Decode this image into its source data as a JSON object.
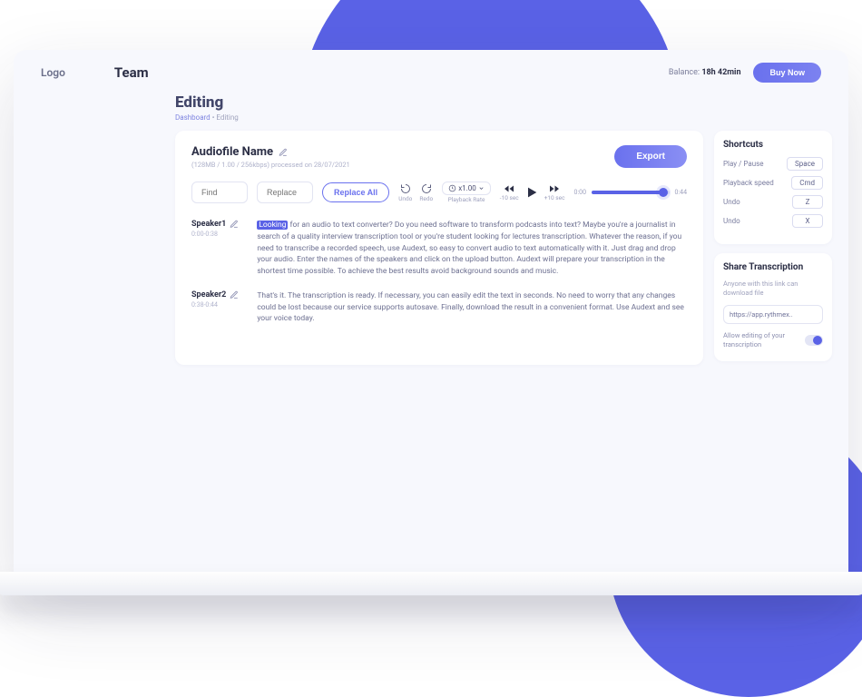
{
  "header": {
    "logo": "Logo",
    "team": "Team",
    "balance_label": "Balance:",
    "balance_value": "18h 42min",
    "buy_now": "Buy Now"
  },
  "page": {
    "title": "Editing",
    "breadcrumb_dashboard": "Dashboard",
    "breadcrumb_sep": " • ",
    "breadcrumb_current": "Editing"
  },
  "file": {
    "name": "Audiofile Name",
    "meta": "(128MB / 1.00 / 256kbps) processed on 28/07/2021",
    "export": "Export"
  },
  "toolbar": {
    "find_ph": "Find",
    "replace_ph": "Replace",
    "replace_all": "Replace All",
    "undo": "Undo",
    "redo": "Redo",
    "rate_label": "Playback Rate",
    "rate_value": "x1.00",
    "back10": "-10 sec",
    "fwd10": "+10 sec",
    "time_start": "0:00",
    "time_end": "0:44",
    "progress_pct": 92
  },
  "transcript": [
    {
      "speaker": "Speaker1",
      "time": "0:00-0:38",
      "highlight": "Looking",
      "text": " for an audio to text converter? Do you need software to transform podcasts into text? Maybe you're a journalist in search of a quality interview transcription tool or you're student looking for lectures transcription. Whatever the reason, if you need to transcribe a recorded speech, use Audext, so easy to convert audio to text automatically with it. Just drag and drop your audio. Enter the names of the speakers and click on the upload button. Audext will prepare your transcription in the shortest time possible. To achieve the best results avoid background sounds and music."
    },
    {
      "speaker": "Speaker2",
      "time": "0:38-0:44",
      "highlight": "",
      "text": "That's it. The transcription is ready. If necessary, you can easily edit the text in seconds. No need to worry that any changes could be lost because our service supports autosave. Finally, download the result in a convenient format. Use Audext and see your voice today."
    }
  ],
  "shortcuts": {
    "title": "Shortcuts",
    "rows": [
      {
        "label": "Play / Pause",
        "key": "Space"
      },
      {
        "label": "Playback speed",
        "key": "Cmd"
      },
      {
        "label": "Undo",
        "key": "Z"
      },
      {
        "label": "Undo",
        "key": "X"
      }
    ]
  },
  "share": {
    "title": "Share Transcription",
    "sub": "Anyone with this link can download file",
    "url": "https://app.rythmex..",
    "allow": "Allow editing of your transcription"
  }
}
